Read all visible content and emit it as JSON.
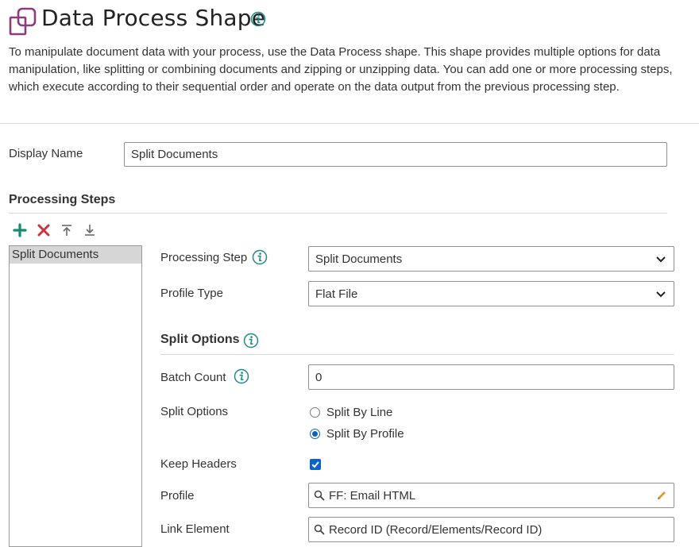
{
  "header": {
    "title": "Data Process Shape",
    "description": "To manipulate document data with your process, use the Data Process shape. This shape provides multiple options for data manipulation, like splitting or combining documents and zipping or unzipping data. You can add one or more processing steps, which execute according to their sequential order and operate on the data output from the previous processing step.",
    "shape_icon": "shape-icon",
    "info_icon": "info-icon"
  },
  "display_name": {
    "label": "Display Name",
    "value": "Split Documents"
  },
  "processing_steps": {
    "title": "Processing Steps",
    "toolbar": [
      "add-icon",
      "delete-icon",
      "move-up-icon",
      "move-down-icon"
    ],
    "items": [
      "Split Documents"
    ]
  },
  "form": {
    "processing_step": {
      "label": "Processing Step",
      "value": "Split Documents"
    },
    "profile_type": {
      "label": "Profile Type",
      "value": "Flat File"
    },
    "split_section_title": "Split Options",
    "batch_count": {
      "label": "Batch Count",
      "value": "0"
    },
    "split_options": {
      "label": "Split Options",
      "options": [
        "Split By Line",
        "Split By Profile"
      ],
      "selected": "Split By Profile"
    },
    "keep_headers": {
      "label": "Keep Headers",
      "checked": true
    },
    "profile": {
      "label": "Profile",
      "value": "FF: Email HTML"
    },
    "link_element": {
      "label": "Link Element",
      "value": "Record ID (Record/Elements/Record ID)"
    }
  },
  "colors": {
    "shape_icon": "#8a3c7d",
    "info": "#1f8a8a",
    "add": "#1a8a6e",
    "delete": "#c8343f",
    "accent": "#0a64c8",
    "pencil": "#e0a030"
  }
}
